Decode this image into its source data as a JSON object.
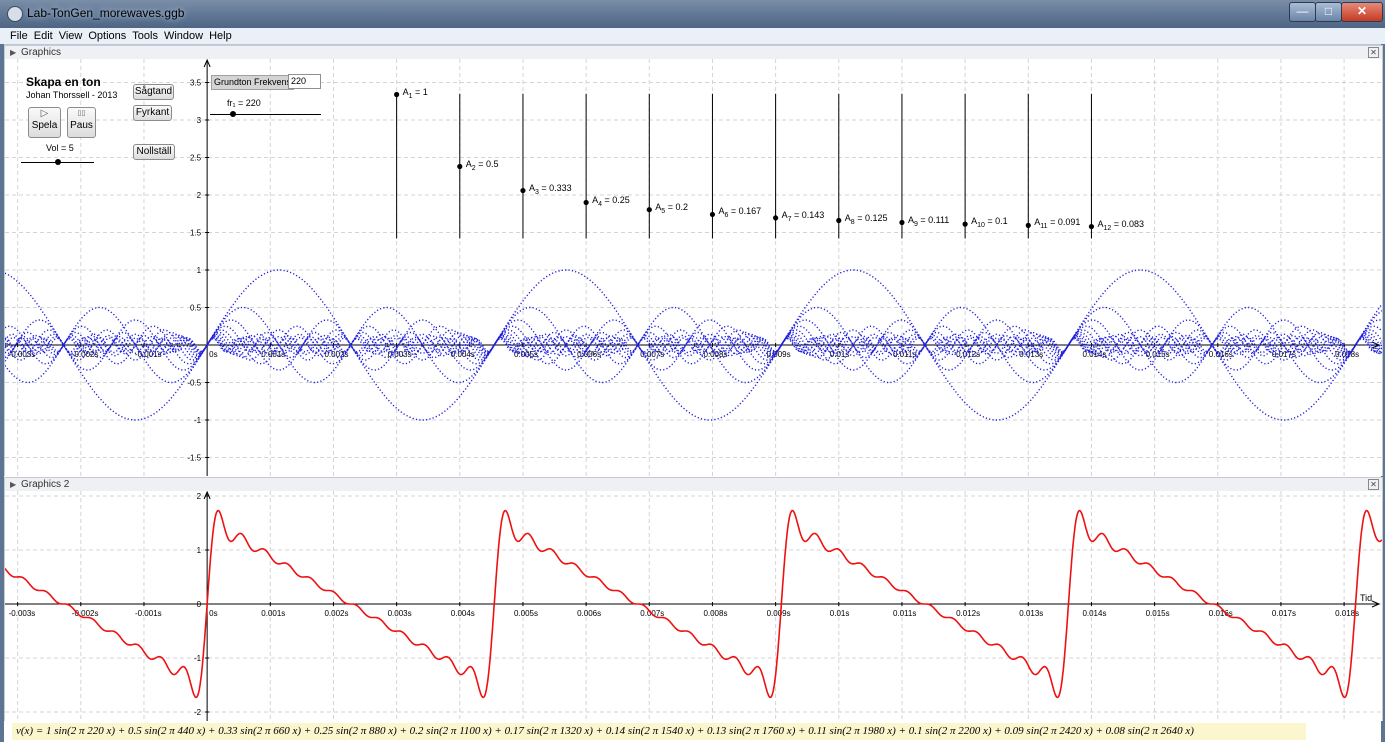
{
  "window": {
    "title": "Lab-TonGen_morewaves.ggb",
    "minimize": "—",
    "maximize": "□",
    "close": "✕"
  },
  "menu": [
    "File",
    "Edit",
    "View",
    "Options",
    "Tools",
    "Window",
    "Help"
  ],
  "panel1": {
    "title": "Graphics"
  },
  "panel2": {
    "title": "Graphics 2"
  },
  "controls": {
    "heading": "Skapa en ton",
    "author": "Johan Thorssell - 2013",
    "play_label": "Spela",
    "pause_label": "Paus",
    "play_icon": "▷",
    "pause_icon": "▯▯",
    "vol_label": "Vol = 5",
    "vol_value": 5,
    "btn_sawtooth": "Sågtand",
    "btn_square": "Fyrkant",
    "btn_reset": "Nollställ",
    "freq_caption": "Grundton Frekvens",
    "freq_value": "220",
    "slider_label": "fr₁ = 220",
    "slider_value": 220
  },
  "amplitudes": [
    {
      "name": "A",
      "sub": "1",
      "value": "1",
      "v": 1
    },
    {
      "name": "A",
      "sub": "2",
      "value": "0.5",
      "v": 0.5
    },
    {
      "name": "A",
      "sub": "3",
      "value": "0.333",
      "v": 0.333
    },
    {
      "name": "A",
      "sub": "4",
      "value": "0.25",
      "v": 0.25
    },
    {
      "name": "A",
      "sub": "5",
      "value": "0.2",
      "v": 0.2
    },
    {
      "name": "A",
      "sub": "6",
      "value": "0.167",
      "v": 0.167
    },
    {
      "name": "A",
      "sub": "7",
      "value": "0.143",
      "v": 0.143
    },
    {
      "name": "A",
      "sub": "8",
      "value": "0.125",
      "v": 0.125
    },
    {
      "name": "A",
      "sub": "9",
      "value": "0.111",
      "v": 0.111
    },
    {
      "name": "A",
      "sub": "10",
      "value": "0.1",
      "v": 0.1
    },
    {
      "name": "A",
      "sub": "11",
      "value": "0.091",
      "v": 0.091
    },
    {
      "name": "A",
      "sub": "12",
      "value": "0.083",
      "v": 0.083
    }
  ],
  "chart_data": [
    {
      "type": "line",
      "title": "",
      "ylim": [
        -1.7,
        3.7
      ],
      "yticks": [
        "3.5",
        "3",
        "2.5",
        "2",
        "1.5",
        "1",
        "0.5",
        "-0.5",
        "-1",
        "-1.5"
      ],
      "ytick_values": [
        3.5,
        3,
        2.5,
        2,
        1.5,
        1,
        0.5,
        -0.5,
        -1,
        -1.5
      ],
      "xlim": [
        -0.0032,
        0.0186
      ],
      "xticks": [
        "-0.003s",
        "-0.002s",
        "-0.001s",
        "0s",
        "0.001s",
        "0.002s",
        "0.003s",
        "0.004s",
        "0.005s",
        "0.006s",
        "0.007s",
        "0.008s",
        "0.009s",
        "0.01s",
        "0.011s",
        "0.012s",
        "0.013s",
        "0.014s",
        "0.015s",
        "0.016s",
        "0.017s",
        "0.018s"
      ],
      "series_color": "#1f1fdf",
      "series": "harmonics A_n sin(2π·n·220·x), n = 1…12, dotted"
    },
    {
      "type": "line",
      "title": "",
      "ylim": [
        -2.1,
        2.1
      ],
      "yticks": [
        "2",
        "1",
        "0",
        "-1",
        "-2"
      ],
      "ytick_values": [
        2,
        1,
        0,
        -1,
        -2
      ],
      "xlim": [
        -0.0032,
        0.0186
      ],
      "xlabel": "Tid",
      "xticks": [
        "-0.003s",
        "-0.002s",
        "-0.001s",
        "0s",
        "0.001s",
        "0.002s",
        "0.003s",
        "0.004s",
        "0.005s",
        "0.006s",
        "0.007s",
        "0.008s",
        "0.009s",
        "0.01s",
        "0.011s",
        "0.012s",
        "0.013s",
        "0.014s",
        "0.015s",
        "0.016s",
        "0.017s",
        "0.018s"
      ],
      "series_color": "#ee1111",
      "series": "v(x) = Σ A_n sin(2π·n·220·x)"
    }
  ],
  "formula": "v(x) = 1 sin(2 π 220 x) + 0.5 sin(2 π 440 x) + 0.33 sin(2 π 660 x) + 0.25 sin(2 π 880 x) + 0.2 sin(2 π 1100 x) + 0.17 sin(2 π 1320 x) + 0.14 sin(2 π 1540 x) + 0.13 sin(2 π 1760 x) + 0.11 sin(2 π 1980 x) + 0.1 sin(2 π 2200 x) + 0.09 sin(2 π 2420 x) + 0.08 sin(2 π 2640 x)"
}
